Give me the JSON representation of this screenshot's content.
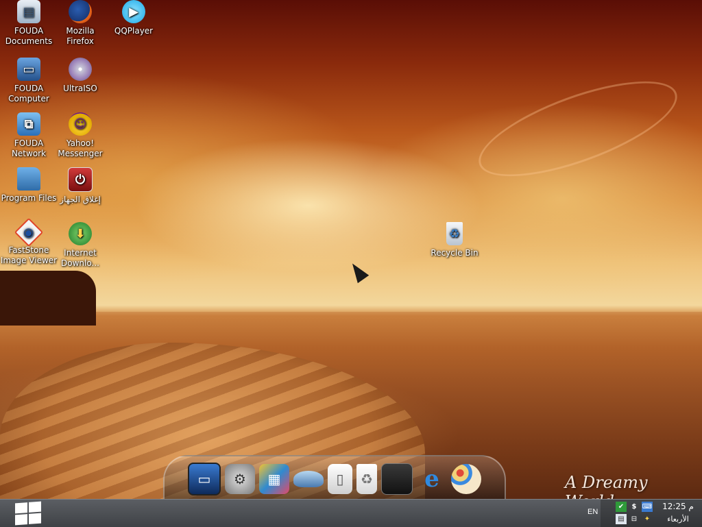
{
  "desktop_icons": [
    {
      "name": "fouda-documents",
      "icon": "documents-icon",
      "line1": "FOUDA",
      "line2": "Documents"
    },
    {
      "name": "mozilla-firefox",
      "icon": "firefox-icon",
      "line1": "Mozilla",
      "line2": "Firefox"
    },
    {
      "name": "qqplayer",
      "icon": "qqplayer-icon",
      "line1": "QQPlayer",
      "line2": ""
    },
    {
      "name": "fouda-computer",
      "icon": "computer-icon",
      "line1": "FOUDA",
      "line2": "Computer"
    },
    {
      "name": "ultraiso",
      "icon": "disc-icon",
      "line1": "UltraISO",
      "line2": ""
    },
    {
      "name": "fouda-network",
      "icon": "network-icon",
      "line1": "FOUDA",
      "line2": "Network"
    },
    {
      "name": "yahoo-messenger",
      "icon": "yahoo-icon",
      "line1": "Yahoo!",
      "line2": "Messenger"
    },
    {
      "name": "program-files",
      "icon": "folder-icon",
      "line1": "Program Files",
      "line2": ""
    },
    {
      "name": "shutdown",
      "icon": "power-icon",
      "line1": "إغلاق الجهاز",
      "line2": ""
    },
    {
      "name": "faststone-image-viewer",
      "icon": "eye-icon",
      "line1": "FastStone",
      "line2": "Image Viewer"
    },
    {
      "name": "internet-download-manager",
      "icon": "globe-download-icon",
      "line1": "Internet",
      "line2": "Downlo..."
    },
    {
      "name": "recycle-bin",
      "icon": "recycle-bin-icon",
      "line1": "Recycle Bin",
      "line2": ""
    }
  ],
  "dock": {
    "items": [
      {
        "name": "monitor",
        "icon": "monitor-icon"
      },
      {
        "name": "system-preferences",
        "icon": "gear-icon"
      },
      {
        "name": "photo-gallery",
        "icon": "photos-icon"
      },
      {
        "name": "drive",
        "icon": "drive-icon"
      },
      {
        "name": "external-disk",
        "icon": "hard-disk-icon"
      },
      {
        "name": "trash",
        "icon": "trash-icon"
      },
      {
        "name": "screen",
        "icon": "screen-icon"
      },
      {
        "name": "internet-explorer",
        "icon": "internet-explorer-icon"
      },
      {
        "name": "paint",
        "icon": "palette-icon"
      }
    ]
  },
  "wallpaper": {
    "watermark": "A Dreamy World"
  },
  "taskbar": {
    "language": "EN",
    "clock_time": "12:25 م",
    "clock_day": "الأربعاء"
  },
  "colors": {
    "taskbar": "#4a4d52",
    "accent": "#ffffff"
  }
}
